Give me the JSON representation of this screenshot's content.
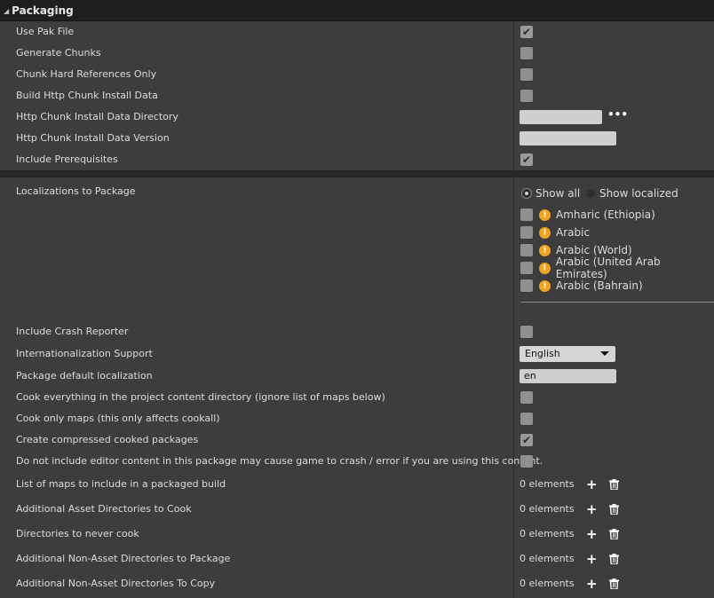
{
  "section": {
    "title": "Packaging"
  },
  "packaging_rows": [
    {
      "label": "Use Pak File",
      "checked": true
    },
    {
      "label": "Generate Chunks",
      "checked": false
    },
    {
      "label": "Chunk Hard References Only",
      "checked": false
    },
    {
      "label": "Build Http Chunk Install Data",
      "checked": false
    },
    {
      "label": "Http Chunk Install Data Directory",
      "value": ""
    },
    {
      "label": "Http Chunk Install Data Version",
      "value": ""
    },
    {
      "label": "Include Prerequisites",
      "checked": true
    }
  ],
  "localizations": {
    "label": "Localizations to Package",
    "show_all": "Show all",
    "show_localized": "Show localized",
    "items": [
      {
        "name": "Amharic (Ethiopia)",
        "checked": false
      },
      {
        "name": "Arabic",
        "checked": false
      },
      {
        "name": "Arabic (World)",
        "checked": false
      },
      {
        "name": "Arabic (United Arab Emirates)",
        "checked": false
      },
      {
        "name": "Arabic (Bahrain)",
        "checked": false
      }
    ]
  },
  "settings": {
    "include_crash_reporter": {
      "label": "Include Crash Reporter",
      "checked": false
    },
    "internationalization": {
      "label": "Internationalization Support",
      "value": "English"
    },
    "default_localization": {
      "label": "Package default localization",
      "value": "en"
    },
    "cook_everything": {
      "label": "Cook everything in the project content directory (ignore list of maps below)",
      "checked": false
    },
    "cook_only_maps": {
      "label": "Cook only maps (this only affects cookall)",
      "checked": false
    },
    "compressed": {
      "label": "Create compressed cooked packages",
      "checked": true
    },
    "no_editor_content": {
      "label": "Do not include editor content in this package may cause game to crash / error if you are using this content.",
      "checked": false
    }
  },
  "arrays": [
    {
      "label": "List of maps to include in a packaged build",
      "count": "0 elements"
    },
    {
      "label": "Additional Asset Directories to Cook",
      "count": "0 elements"
    },
    {
      "label": "Directories to never cook",
      "count": "0 elements"
    },
    {
      "label": "Additional Non-Asset Directories to Package",
      "count": "0 elements"
    },
    {
      "label": "Additional Non-Asset Directories To Copy",
      "count": "0 elements"
    }
  ],
  "icons": {
    "add": "plus-icon",
    "remove": "trash-icon",
    "warning": "warning-icon",
    "browse": "ellipsis-icon"
  }
}
